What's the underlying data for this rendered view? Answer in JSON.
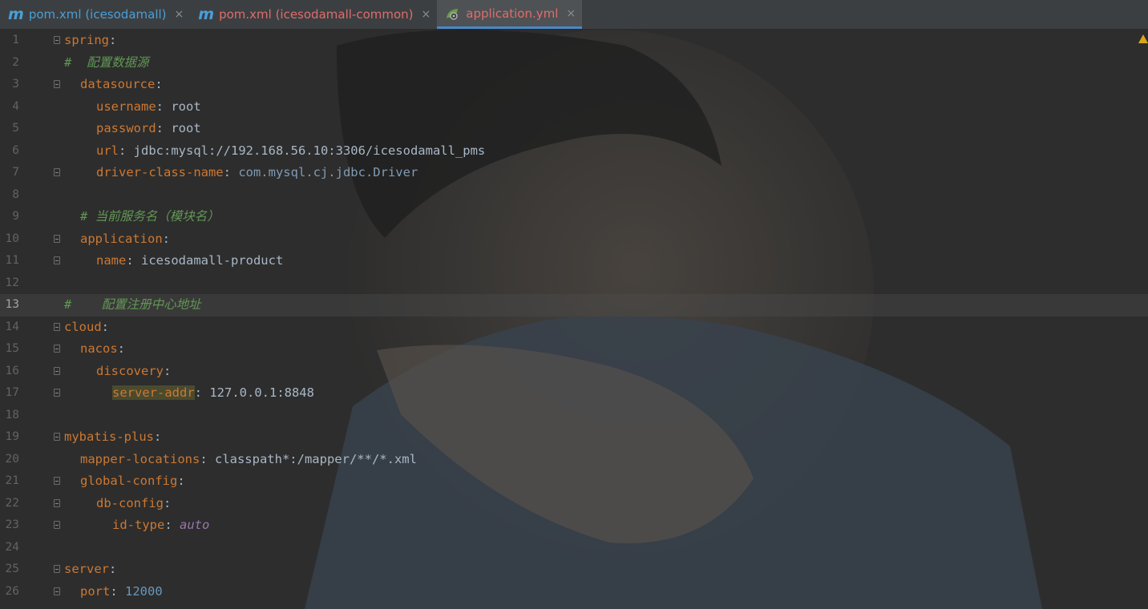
{
  "tabs": [
    {
      "icon": "m",
      "label": "pom.xml (icesodamall)",
      "color": "#4a9fd8",
      "active": false
    },
    {
      "icon": "m",
      "label": "pom.xml (icesodamall-common)",
      "color": "#e06c6c",
      "active": false
    },
    {
      "icon": "leaf",
      "label": "application.yml",
      "color": "#e06c6c",
      "active": true
    }
  ],
  "tab_close": "×",
  "current_line": 13,
  "lines": [
    {
      "n": "1",
      "fold": true,
      "indent": 0,
      "parts": [
        [
          "k",
          "spring"
        ],
        [
          "p",
          ":"
        ]
      ]
    },
    {
      "n": "2",
      "fold": false,
      "indent": 0,
      "parts": [
        [
          "cm",
          "#  配置数据源"
        ]
      ]
    },
    {
      "n": "3",
      "fold": true,
      "indent": 1,
      "parts": [
        [
          "k",
          "datasource"
        ],
        [
          "p",
          ":"
        ]
      ]
    },
    {
      "n": "4",
      "fold": false,
      "indent": 2,
      "parts": [
        [
          "k",
          "username"
        ],
        [
          "p",
          ": "
        ],
        [
          "v",
          "root"
        ]
      ]
    },
    {
      "n": "5",
      "fold": false,
      "indent": 2,
      "parts": [
        [
          "k",
          "password"
        ],
        [
          "p",
          ": "
        ],
        [
          "v",
          "root"
        ]
      ]
    },
    {
      "n": "6",
      "fold": false,
      "indent": 2,
      "parts": [
        [
          "k",
          "url"
        ],
        [
          "p",
          ": "
        ],
        [
          "v",
          "jdbc:mysql://192.168.56.10:3306/icesodamall_pms"
        ]
      ]
    },
    {
      "n": "7",
      "fold": true,
      "indent": 2,
      "parts": [
        [
          "k",
          "driver-class-name"
        ],
        [
          "p",
          ": "
        ],
        [
          "cls",
          "com.mysql.cj.jdbc.Driver"
        ]
      ]
    },
    {
      "n": "8",
      "fold": false,
      "indent": 0,
      "parts": []
    },
    {
      "n": "9",
      "fold": false,
      "indent": 1,
      "parts": [
        [
          "cm",
          "# 当前服务名（模块名）"
        ]
      ]
    },
    {
      "n": "10",
      "fold": true,
      "indent": 1,
      "parts": [
        [
          "k",
          "application"
        ],
        [
          "p",
          ":"
        ]
      ]
    },
    {
      "n": "11",
      "fold": true,
      "indent": 2,
      "parts": [
        [
          "k",
          "name"
        ],
        [
          "p",
          ": "
        ],
        [
          "v",
          "icesodamall-product"
        ]
      ]
    },
    {
      "n": "12",
      "fold": false,
      "indent": 0,
      "parts": []
    },
    {
      "n": "13",
      "fold": false,
      "indent": 0,
      "parts": [
        [
          "cm",
          "#    配置注册中心地址"
        ]
      ]
    },
    {
      "n": "14",
      "fold": true,
      "indent": 0,
      "parts": [
        [
          "k",
          "cloud"
        ],
        [
          "p",
          ":"
        ]
      ]
    },
    {
      "n": "15",
      "fold": true,
      "indent": 1,
      "parts": [
        [
          "k",
          "nacos"
        ],
        [
          "p",
          ":"
        ]
      ]
    },
    {
      "n": "16",
      "fold": true,
      "indent": 2,
      "parts": [
        [
          "k",
          "discovery"
        ],
        [
          "p",
          ":"
        ]
      ]
    },
    {
      "n": "17",
      "fold": true,
      "indent": 3,
      "parts": [
        [
          "khl",
          "server-addr"
        ],
        [
          "p",
          ": "
        ],
        [
          "v",
          "127.0.0.1:8848"
        ]
      ]
    },
    {
      "n": "18",
      "fold": false,
      "indent": 0,
      "parts": []
    },
    {
      "n": "19",
      "fold": true,
      "indent": 0,
      "parts": [
        [
          "k",
          "mybatis-plus"
        ],
        [
          "p",
          ":"
        ]
      ]
    },
    {
      "n": "20",
      "fold": false,
      "indent": 1,
      "parts": [
        [
          "k",
          "mapper-locations"
        ],
        [
          "p",
          ": "
        ],
        [
          "v",
          "classpath*:/mapper/**/*.xml"
        ]
      ]
    },
    {
      "n": "21",
      "fold": true,
      "indent": 1,
      "parts": [
        [
          "k",
          "global-config"
        ],
        [
          "p",
          ":"
        ]
      ]
    },
    {
      "n": "22",
      "fold": true,
      "indent": 2,
      "parts": [
        [
          "k",
          "db-config"
        ],
        [
          "p",
          ":"
        ]
      ]
    },
    {
      "n": "23",
      "fold": true,
      "indent": 3,
      "parts": [
        [
          "k",
          "id-type"
        ],
        [
          "p",
          ": "
        ],
        [
          "kw",
          "auto"
        ]
      ]
    },
    {
      "n": "24",
      "fold": false,
      "indent": 0,
      "parts": []
    },
    {
      "n": "25",
      "fold": true,
      "indent": 0,
      "parts": [
        [
          "k",
          "server"
        ],
        [
          "p",
          ":"
        ]
      ]
    },
    {
      "n": "26",
      "fold": true,
      "indent": 1,
      "parts": [
        [
          "k",
          "port"
        ],
        [
          "p",
          ": "
        ],
        [
          "num",
          "12000"
        ]
      ]
    }
  ]
}
